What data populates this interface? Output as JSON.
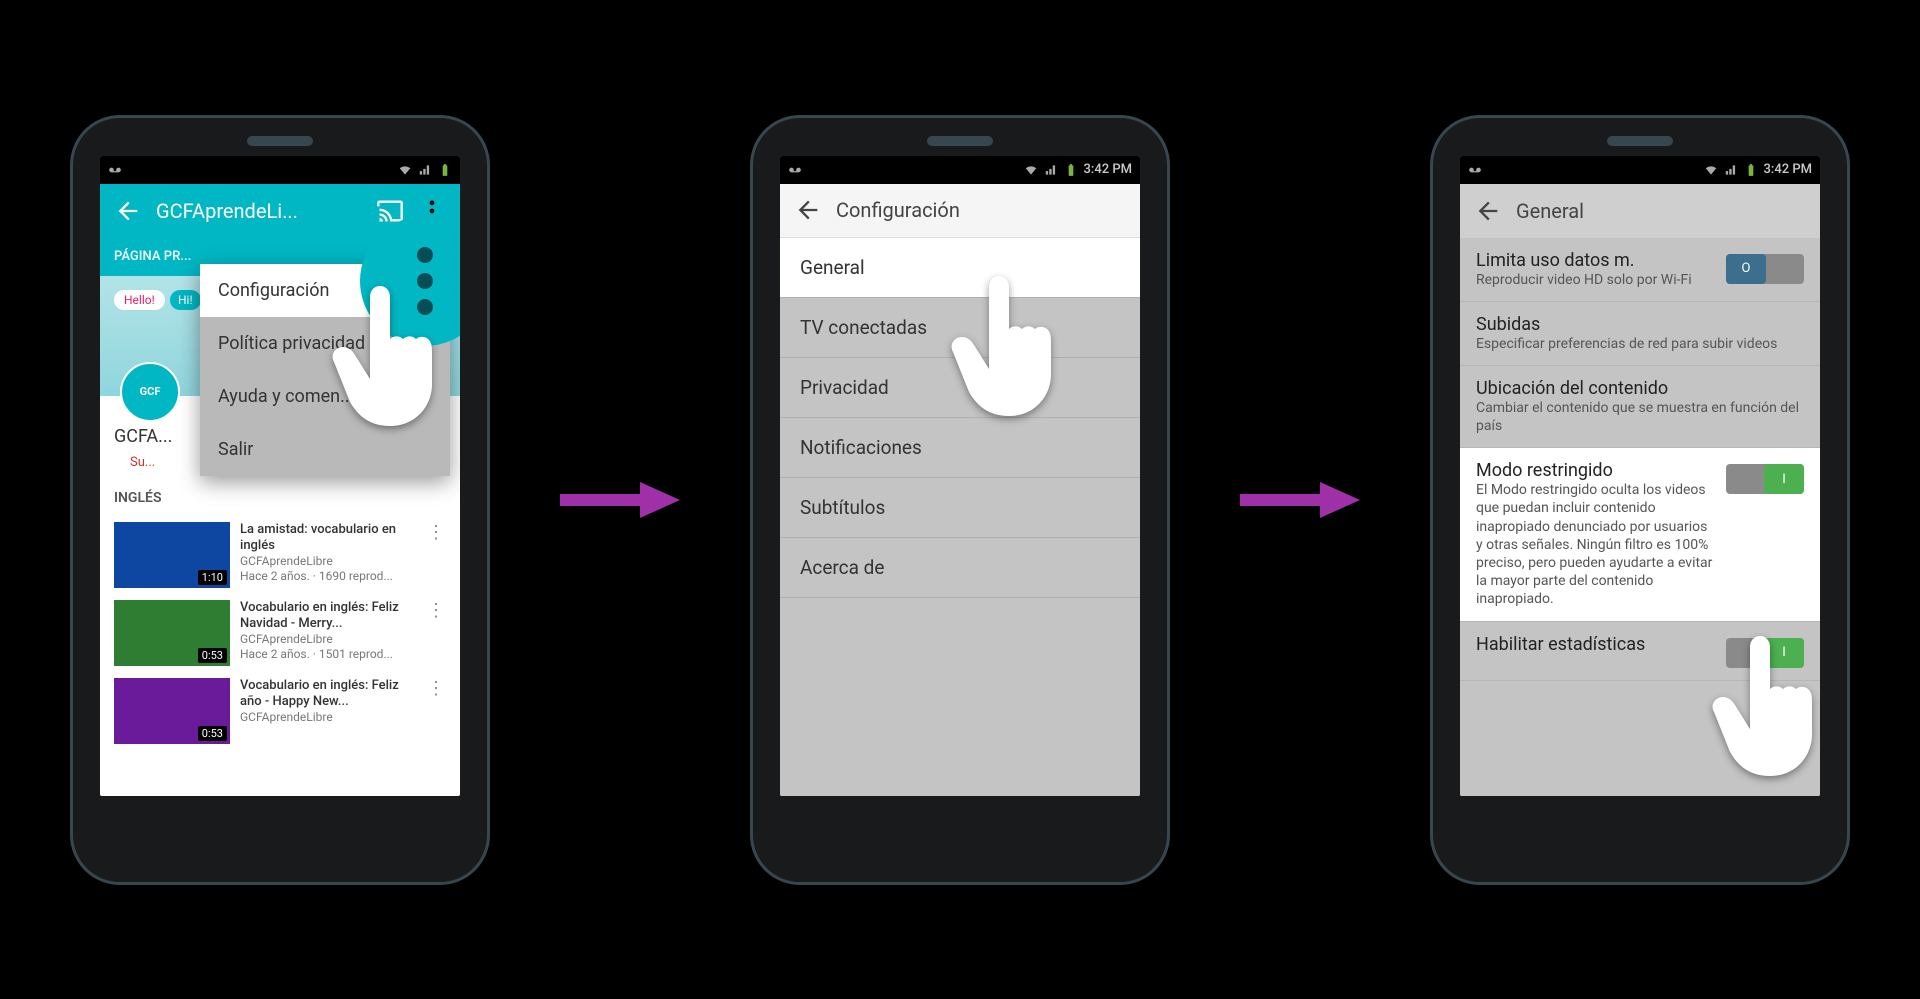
{
  "status": {
    "time": "3:42 PM"
  },
  "phone1": {
    "appbar_title": "GCFAprendeLi...",
    "tab_label": "PÁGINA PR...",
    "banner_hello": "Hello!",
    "banner_hi": "Hi!",
    "chip": "GCF",
    "channel_name": "GCFA...",
    "subscribe": "Su...",
    "section": "INGLÉS",
    "videos": [
      {
        "title": "La amistad: vocabulario en inglés",
        "channel": "GCFAprendeLibre",
        "meta": "Hace 2 años. · 1690 reprod...",
        "duration": "1:10"
      },
      {
        "title": "Vocabulario en inglés: Feliz Navidad - Merry...",
        "channel": "GCFAprendeLibre",
        "meta": "Hace 2 años. · 1501 reprod...",
        "duration": "0:53"
      },
      {
        "title": "Vocabulario en inglés: Feliz año - Happy New...",
        "channel": "GCFAprendeLibre",
        "meta": "",
        "duration": "0:53"
      }
    ],
    "menu": {
      "config": "Configuración",
      "privacy": "Política privacidad",
      "help": "Ayuda y comen...",
      "exit": "Salir"
    }
  },
  "phone2": {
    "title": "Configuración",
    "items": {
      "general": "General",
      "tv": "TV conectadas",
      "privacy": "Privacidad",
      "notif": "Notificaciones",
      "subs": "Subtítulos",
      "about": "Acerca de"
    }
  },
  "phone3": {
    "title": "General",
    "rows": {
      "limit": {
        "t": "Limita uso datos m.",
        "d": "Reproducir video HD solo por Wi-Fi"
      },
      "uploads": {
        "t": "Subidas",
        "d": "Especificar preferencias de red para subir videos"
      },
      "loc": {
        "t": "Ubicación del contenido",
        "d": "Cambiar el contenido que se muestra en función del país"
      },
      "restr": {
        "t": "Modo restringido",
        "d": "El Modo restringido oculta los videos que puedan incluir contenido inapropiado denunciado por usuarios y otras señales. Ningún filtro es 100% preciso, pero pueden ayudarte a evitar la mayor parte del contenido inapropiado."
      },
      "stats": {
        "t": "Habilitar estadísticas",
        "d": ""
      }
    },
    "switch_off_label": "O",
    "switch_on_label": "I"
  }
}
